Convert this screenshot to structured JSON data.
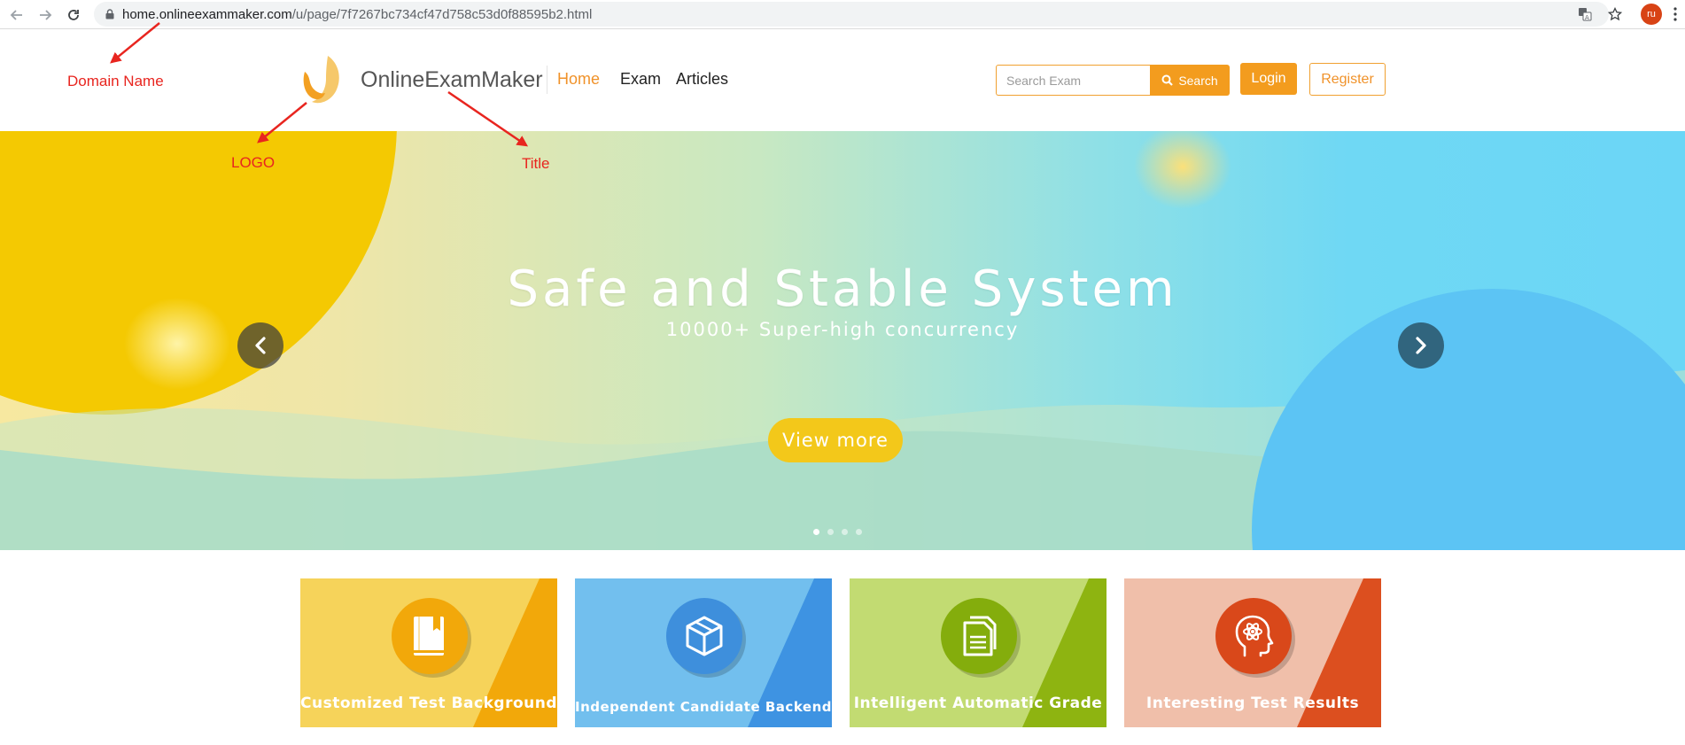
{
  "browser": {
    "url_host": "home.onlineexammaker.com",
    "url_path": "/u/page/7f7267bc734cf47d758c53d0f88595b2.html",
    "profile_initials": "ru"
  },
  "header": {
    "site_title": "OnlineExamMaker",
    "nav": [
      {
        "label": "Home"
      },
      {
        "label": "Exam"
      },
      {
        "label": "Articles"
      }
    ],
    "search_placeholder": "Search Exam",
    "search_label": "Search",
    "login_label": "Login",
    "register_label": "Register",
    "accent_color": "#f39c1e"
  },
  "annotations": {
    "domain_name": "Domain Name",
    "logo": "LOGO",
    "title": "Title",
    "color": "#e8251f"
  },
  "hero": {
    "title": "Safe and Stable System",
    "subtitle": "10000+ Super-high concurrency",
    "cta_label": "View more",
    "slide_count": 4,
    "active_slide": 1
  },
  "cards": [
    {
      "label": "Customized Test Background",
      "icon": "book-icon",
      "base": "#f6d35a",
      "accent": "#f2a80a",
      "circle": "#f2a80a"
    },
    {
      "label": "Independent Candidate Backend",
      "icon": "cube-icon",
      "base": "#72bfee",
      "accent": "#3e93e2",
      "circle": "#3e8fdc"
    },
    {
      "label": "Intelligent Automatic Grade",
      "icon": "document-icon",
      "base": "#c2db72",
      "accent": "#8eb411",
      "circle": "#84ad0c"
    },
    {
      "label": "Interesting Test Results",
      "icon": "atom-head-icon",
      "base": "#f0bfaa",
      "accent": "#dc4f1f",
      "circle": "#d9481a"
    }
  ]
}
